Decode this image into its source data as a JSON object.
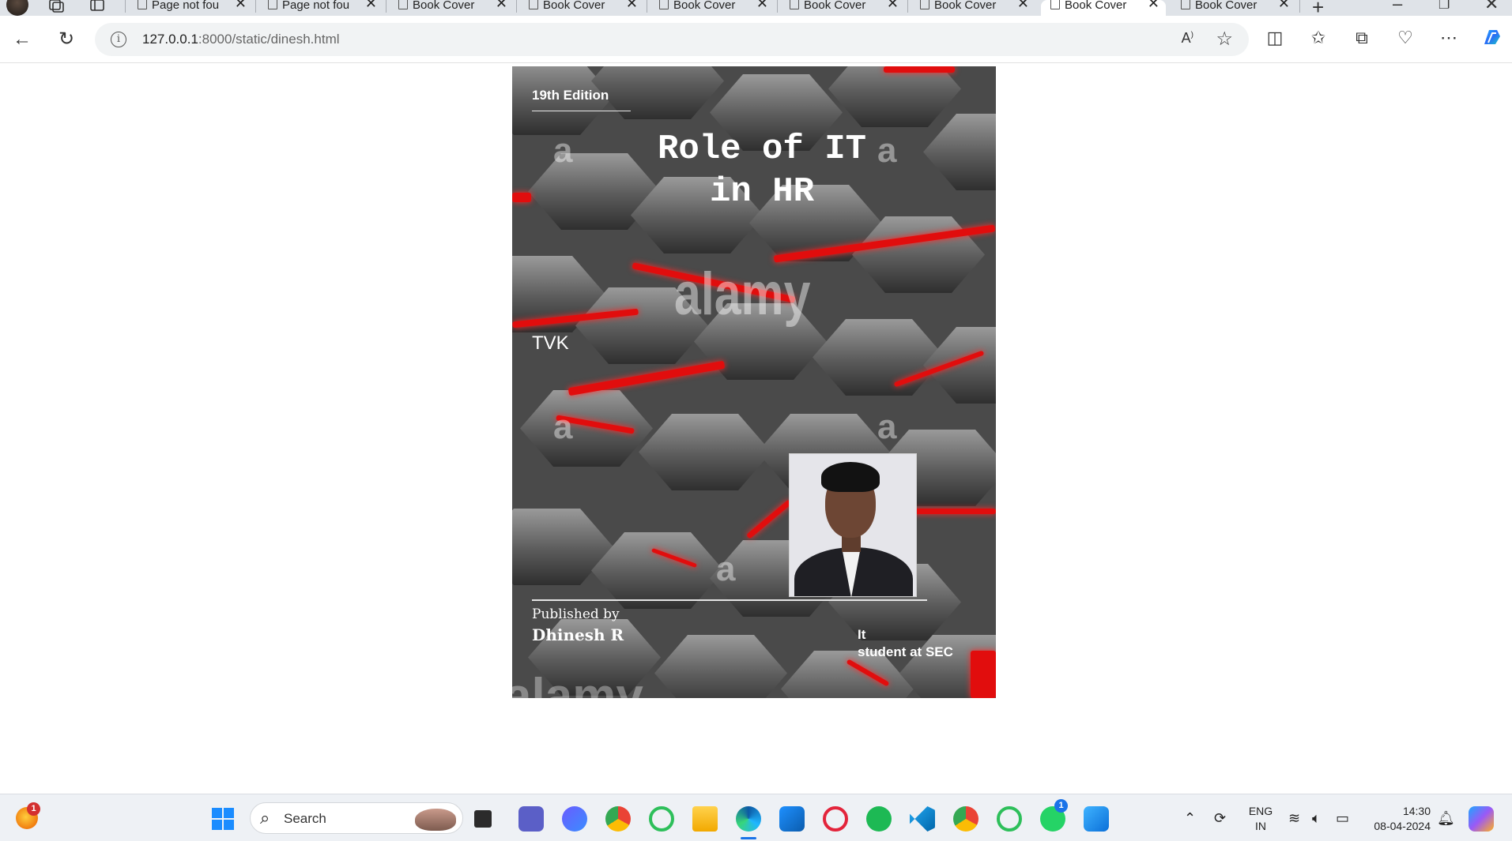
{
  "browser": {
    "tabs": [
      {
        "title": "Page not fou",
        "active": false
      },
      {
        "title": "Page not fou",
        "active": false
      },
      {
        "title": "Book Cover",
        "active": false
      },
      {
        "title": "Book Cover",
        "active": false
      },
      {
        "title": "Book Cover",
        "active": false
      },
      {
        "title": "Book Cover",
        "active": false
      },
      {
        "title": "Book Cover",
        "active": false
      },
      {
        "title": "Book Cover",
        "active": true
      },
      {
        "title": "Book Cover",
        "active": false
      }
    ],
    "new_tab_symbol": "+",
    "address": {
      "host": "127.0.0.1",
      "rest": ":8000/static/dinesh.html"
    },
    "icons": [
      "back-icon",
      "refresh-icon",
      "info-icon",
      "read-aloud-icon",
      "favorite-star-icon",
      "split-screen-icon",
      "favorites-icon",
      "collections-icon",
      "browser-essentials-icon",
      "more-icon",
      "copilot-icon"
    ]
  },
  "cover": {
    "edition": "19th Edition",
    "title_line1": "Role of IT",
    "title_line2": "in HR",
    "watermark": "alamy",
    "watermark_letter": "a",
    "author_tag": "TVK",
    "published_by_label": "Published by",
    "publisher_name": "Dhinesh R",
    "role_line1": "It",
    "role_line2": "student at SEC",
    "accent_color": "#e10d0d"
  },
  "taskbar": {
    "search_placeholder": "Search",
    "notification_badge": "1",
    "whatsapp_badge": "1",
    "language_line1": "ENG",
    "language_line2": "IN",
    "time": "14:30",
    "date": "08-04-2024",
    "apps": [
      "windows-start",
      "file-explorer",
      "teams",
      "vpn",
      "chrome",
      "ring-app",
      "folder",
      "edge",
      "store",
      "opera",
      "spotify",
      "vscode",
      "chrome-profile",
      "ring-app-2",
      "whatsapp",
      "photos"
    ]
  }
}
